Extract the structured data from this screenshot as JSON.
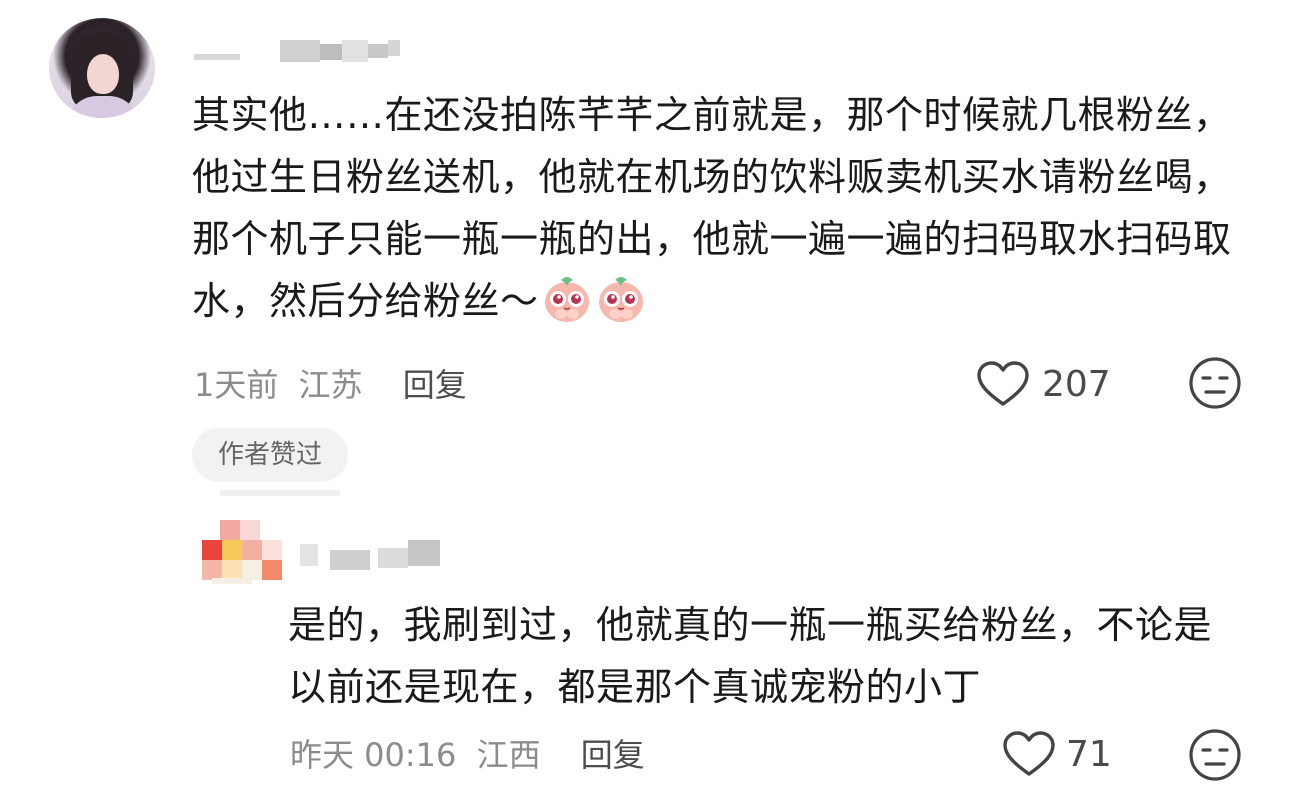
{
  "comment1": {
    "text": "其实他……在还没拍陈芊芊之前就是，那个时候就几根粉丝，他过生日粉丝送机，他就在机场的饮料贩卖机买水请粉丝喝，那个机子只能一瓶一瓶的出，他就一遍一遍的扫码取水扫码取水，然后分给粉丝～",
    "time": "1天前",
    "location": "江苏",
    "reply_label": "回复",
    "like_count": "207",
    "badge": "作者赞过",
    "emoji_icons": [
      "pleading-face-icon",
      "pleading-face-icon"
    ]
  },
  "comment2": {
    "text": "是的，我刷到过，他就真的一瓶一瓶买给粉丝，不论是以前还是现在，都是那个真诚宠粉的小丁",
    "time": "昨天 00:16",
    "location": "江西",
    "reply_label": "回复",
    "like_count": "71"
  },
  "colors": {
    "text": "#1a1a1a",
    "meta": "#8c8c8c",
    "badge_bg": "#f2f2f2"
  }
}
